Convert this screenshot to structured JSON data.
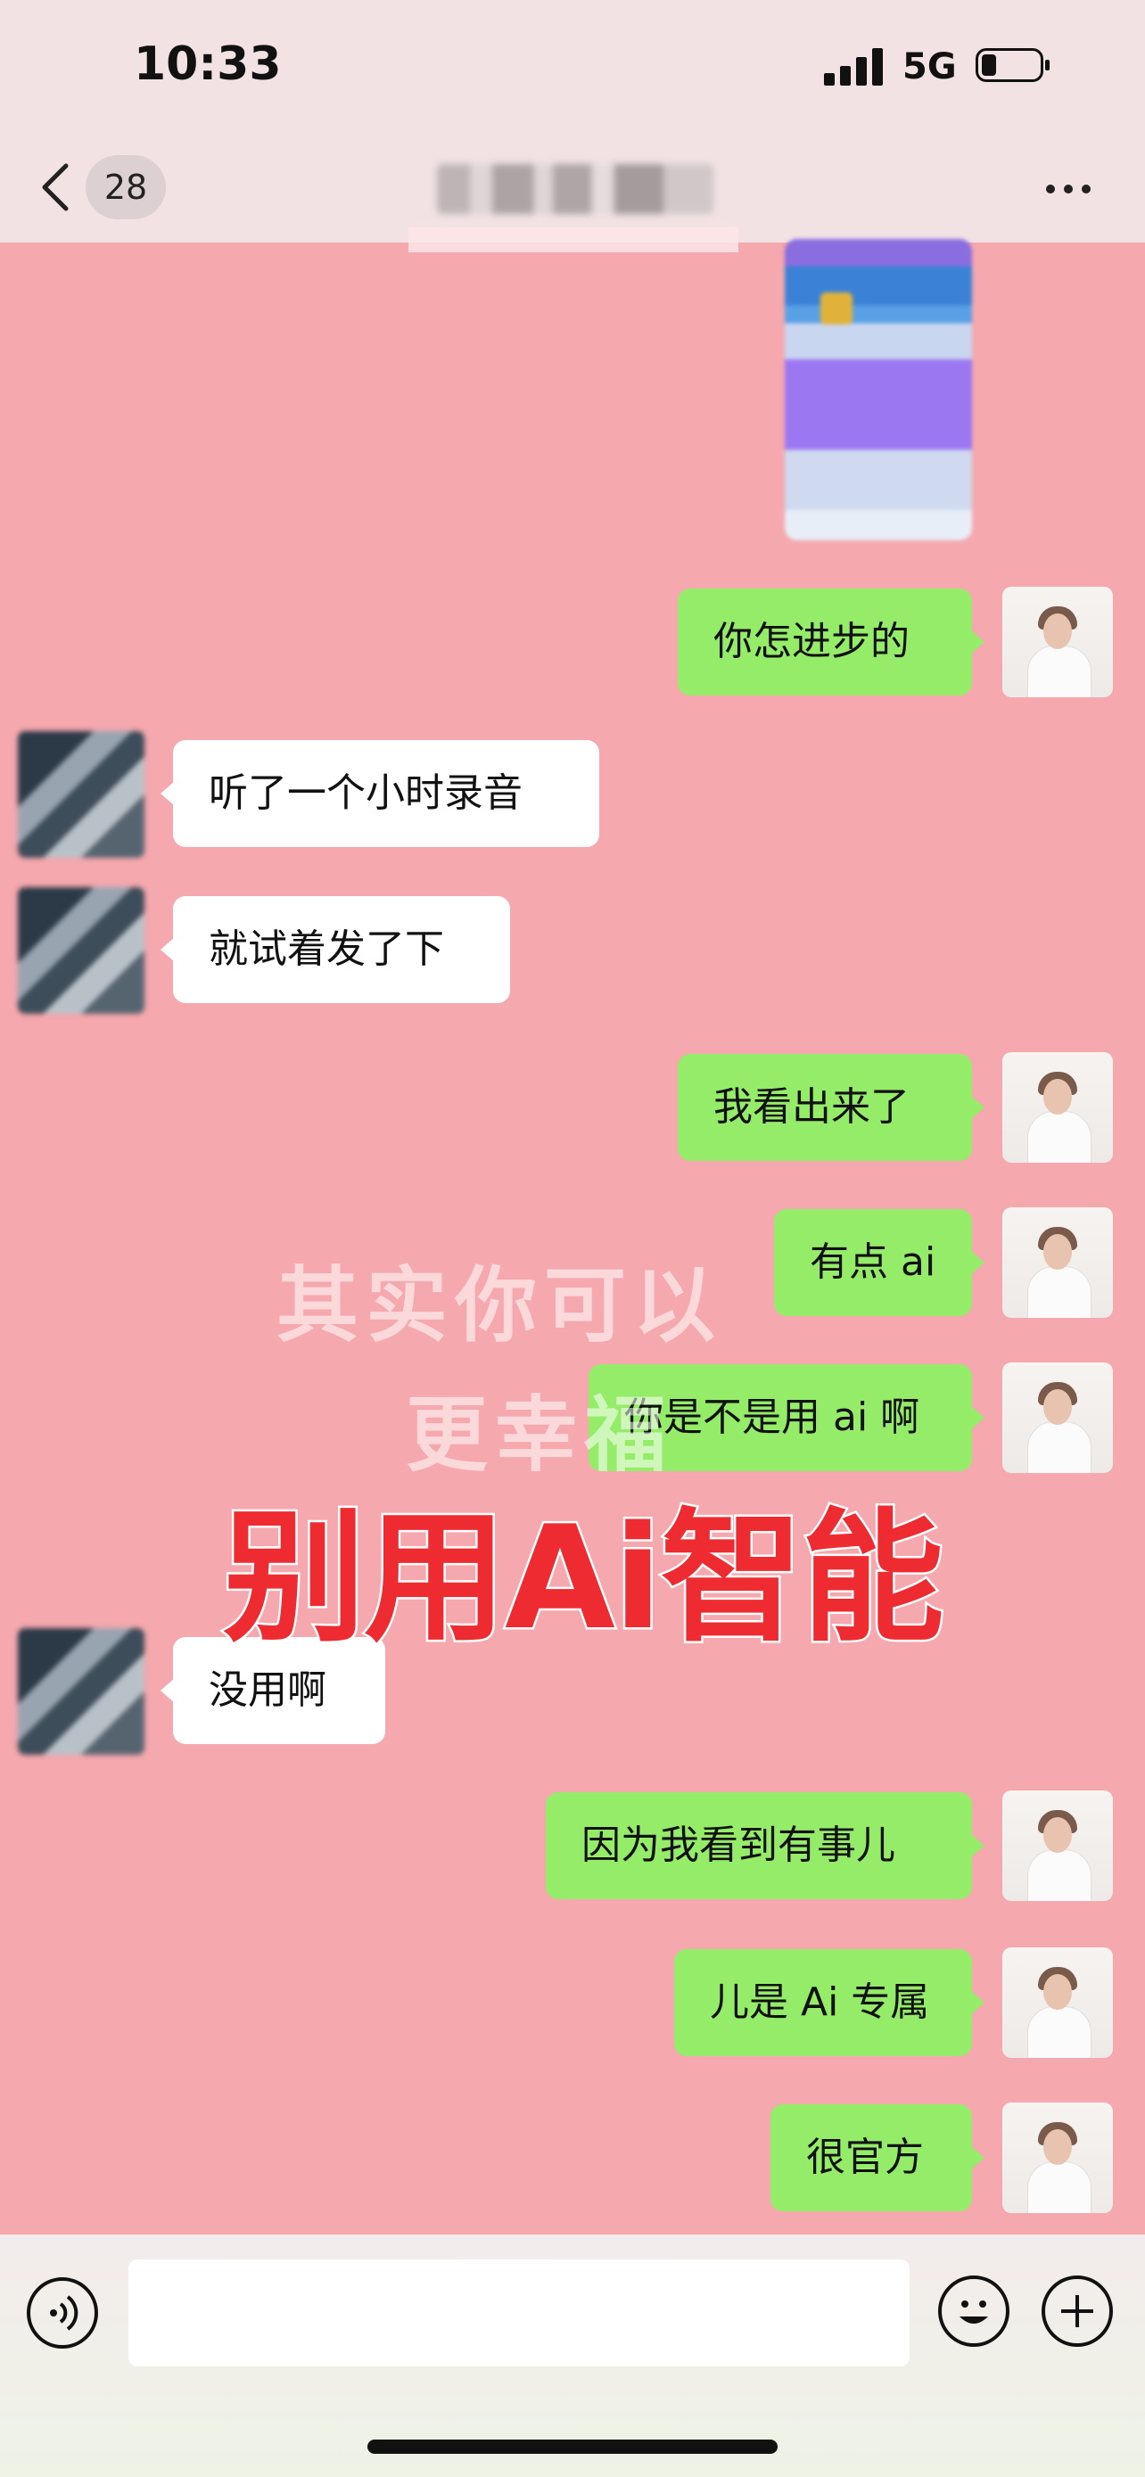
{
  "status_bar": {
    "time": "10:33",
    "network": "5G"
  },
  "nav": {
    "unread_count": "28"
  },
  "messages": [
    {
      "side": "right",
      "text": "你怎进步的"
    },
    {
      "side": "left",
      "text": "听了一个小时录音"
    },
    {
      "side": "left",
      "text": "就试着发了下"
    },
    {
      "side": "right",
      "text": "我看出来了"
    },
    {
      "side": "right",
      "text": "有点 ai"
    },
    {
      "side": "right",
      "text": "你是不是用 ai 啊"
    },
    {
      "side": "left",
      "text": "没用啊"
    },
    {
      "side": "right",
      "text": "因为我看到有事儿"
    },
    {
      "side": "right",
      "text": "儿是 Ai 专属"
    },
    {
      "side": "right",
      "text": "很官方"
    }
  ],
  "overlay": {
    "line1": "其实你可以",
    "line2": "更幸福",
    "headline": "别用Ai智能"
  },
  "colors": {
    "chat_bg": "#f5a8ae",
    "sent_bubble": "#95ec69",
    "received_bubble": "#ffffff",
    "headline": "#ee2b31"
  },
  "icons": [
    "back-chevron-icon",
    "more-icon",
    "voice-icon",
    "emoji-icon",
    "plus-icon"
  ]
}
